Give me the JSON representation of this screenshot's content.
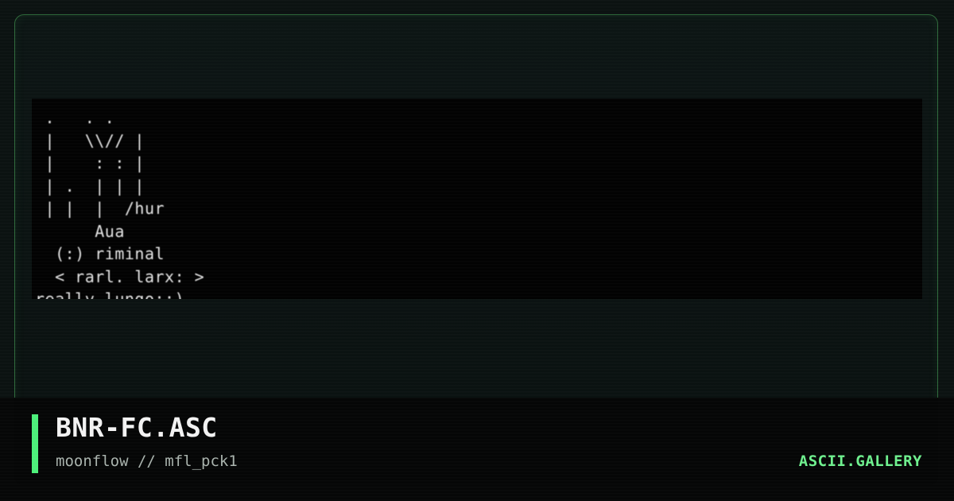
{
  "artwork": {
    "ascii": " .   . .\n |   \\\\// |\n |    : : |\n | .  | | |\n | |  |  /hur\n      Aua\n  (:) riminal\n  < rarl. larx: >\nreally lungo::)"
  },
  "caption": {
    "title": "BNR-FC.ASC",
    "subtitle": "moonflow // mfl_pck1",
    "brand": "ASCII.GALLERY"
  },
  "colors": {
    "accent": "#4cf07a",
    "border": "#2f6b3c",
    "background": "#0b1211"
  }
}
